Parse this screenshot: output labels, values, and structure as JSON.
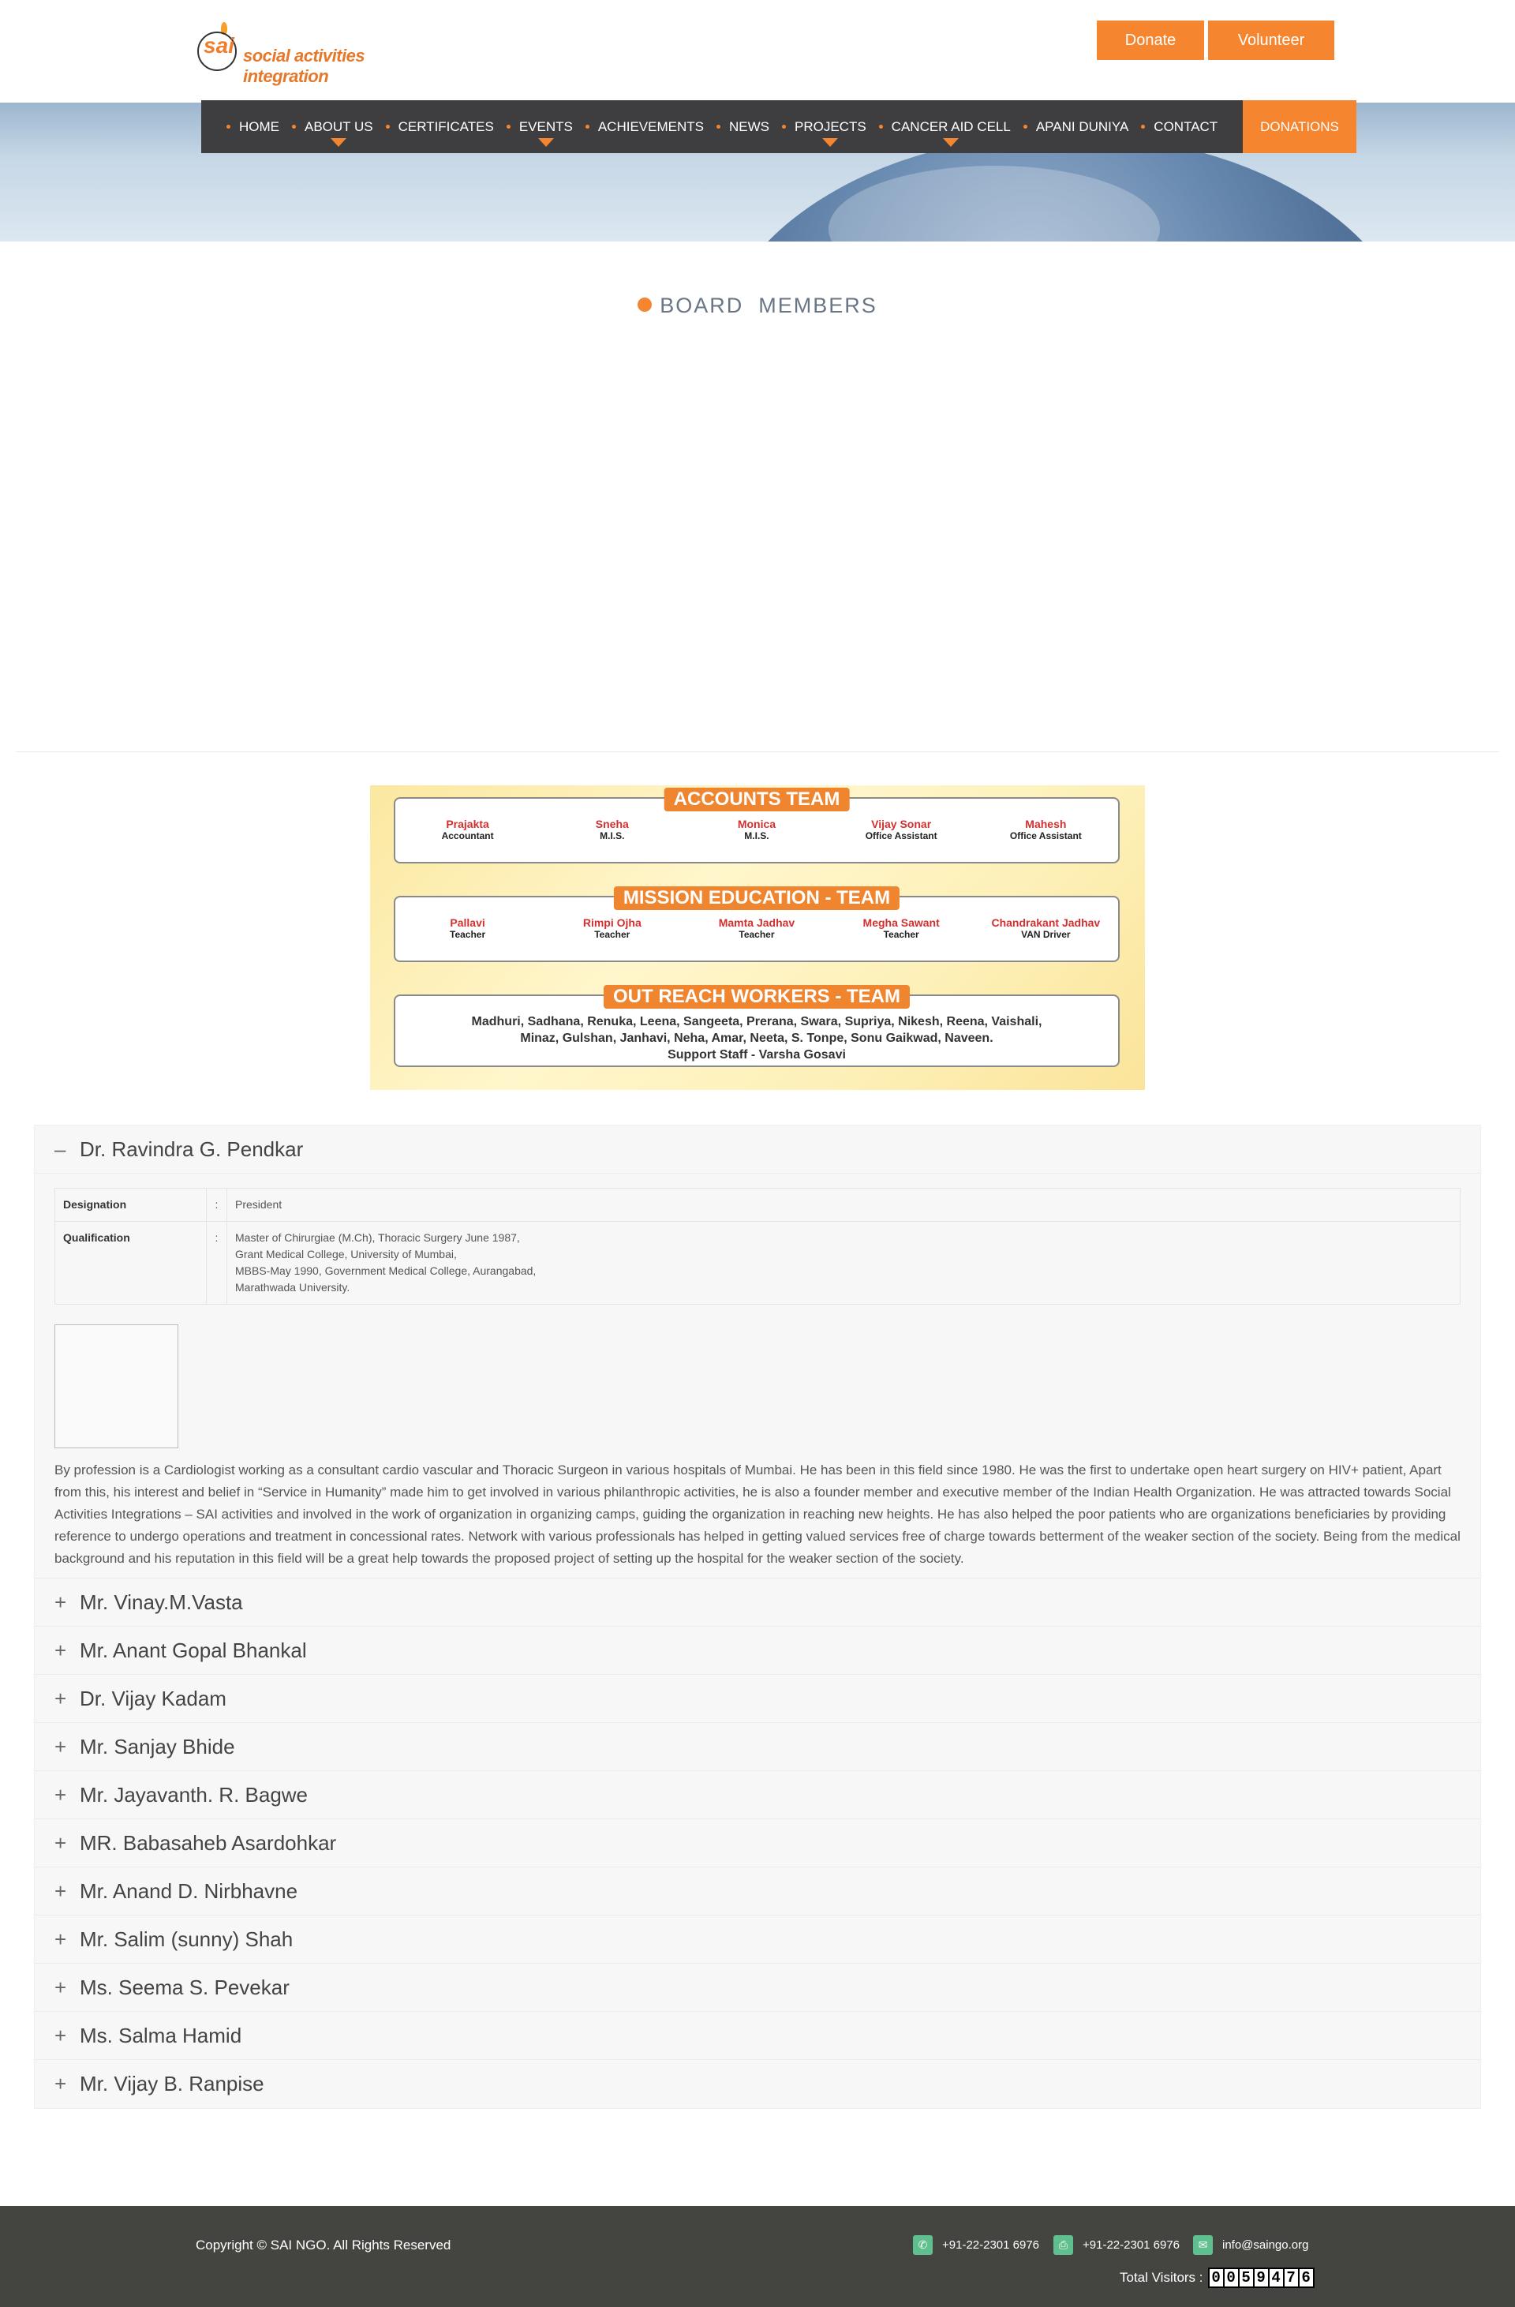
{
  "header": {
    "logo_mark": "sai",
    "logo_text": "social activities integration",
    "donate_label": "Donate",
    "volunteer_label": "Volunteer"
  },
  "nav": {
    "items": [
      {
        "label": "HOME",
        "has_dropdown": false
      },
      {
        "label": "ABOUT US",
        "has_dropdown": true
      },
      {
        "label": "CERTIFICATES",
        "has_dropdown": false
      },
      {
        "label": "EVENTS",
        "has_dropdown": true
      },
      {
        "label": "ACHIEVEMENTS",
        "has_dropdown": false
      },
      {
        "label": "NEWS",
        "has_dropdown": false
      },
      {
        "label": "PROJECTS",
        "has_dropdown": true
      },
      {
        "label": "CANCER AID CELL",
        "has_dropdown": true
      },
      {
        "label": "APANI DUNIYA",
        "has_dropdown": false
      },
      {
        "label": "CONTACT",
        "has_dropdown": false
      }
    ],
    "donations_label": "DONATIONS"
  },
  "page_title": "BOARD  MEMBERS",
  "teams": {
    "accounts": {
      "title": "ACCOUNTS TEAM",
      "members": [
        {
          "name": "Prajakta",
          "role": "Accountant"
        },
        {
          "name": "Sneha",
          "role": "M.I.S."
        },
        {
          "name": "Monica",
          "role": "M.I.S."
        },
        {
          "name": "Vijay Sonar",
          "role": "Office Assistant"
        },
        {
          "name": "Mahesh",
          "role": "Office Assistant"
        }
      ]
    },
    "mission": {
      "title": "MISSION EDUCATION - TEAM",
      "members": [
        {
          "name": "Pallavi",
          "role": "Teacher"
        },
        {
          "name": "Rimpi Ojha",
          "role": "Teacher"
        },
        {
          "name": "Mamta Jadhav",
          "role": "Teacher"
        },
        {
          "name": "Megha Sawant",
          "role": "Teacher"
        },
        {
          "name": "Chandrakant Jadhav",
          "role": "VAN Driver"
        }
      ]
    },
    "outreach": {
      "title": "OUT REACH WORKERS - TEAM",
      "line1": "Madhuri, Sadhana, Renuka, Leena, Sangeeta, Prerana, Swara, Supriya, Nikesh, Reena, Vaishali,",
      "line2": "Minaz, Gulshan, Janhavi, Neha, Amar, Neeta, S. Tonpe, Sonu Gaikwad, Naveen.",
      "line3": "Support Staff - Varsha Gosavi"
    }
  },
  "accordion": {
    "open": {
      "sign": "–",
      "name": "Dr. Ravindra G. Pendkar",
      "designation_label": "Designation",
      "designation_value": "President",
      "qualification_label": "Qualification",
      "colon": ":",
      "qualification_lines": [
        "Master of Chirurgiae (M.Ch), Thoracic Surgery June 1987,",
        "Grant Medical College, University of Mumbai,",
        "MBBS-May 1990, Government Medical College, Aurangabad,",
        "Marathwada University."
      ],
      "bio": "By profession is a Cardiologist working as a consultant cardio vascular and Thoracic Surgeon in various hospitals of Mumbai. He has been in this field since 1980. He was the first to undertake open heart surgery on HIV+ patient, Apart from this, his interest and belief in “Service in Humanity” made him to get involved in various philanthropic activities, he is also a founder member and executive member of the Indian Health Organization. He was attracted towards Social Activities Integrations – SAI activities and involved in the work of organization in organizing camps, guiding the organization in reaching new heights. He has also helped the poor patients who are organizations beneficiaries by providing reference to undergo operations and treatment in concessional rates. Network with various professionals has helped in getting valued services free of charge towards betterment of the weaker section of the society. Being from the medical background and his reputation in this field will be a great help towards the proposed project of setting up the hospital for the weaker section of the society."
    },
    "collapsed_sign": "+",
    "collapsed": [
      "Mr. Vinay.M.Vasta",
      "Mr. Anant Gopal Bhankal",
      "Dr. Vijay Kadam",
      "Mr. Sanjay Bhide",
      "Mr. Jayavanth. R. Bagwe",
      "MR. Babasaheb Asardohkar",
      "Mr. Anand D. Nirbhavne",
      "Mr. Salim (sunny) Shah",
      "Ms. Seema S. Pevekar",
      "Ms. Salma Hamid",
      "Mr. Vijay B. Ranpise"
    ]
  },
  "footer": {
    "copyright": "Copyright © SAI NGO. All Rights Reserved",
    "phone": "+91-22-2301 6976",
    "fax": "+91-22-2301 6976",
    "email": "info@saingo.org",
    "visitors_label": "Total Visitors :",
    "visitor_digits": [
      "0",
      "0",
      "5",
      "9",
      "4",
      "7",
      "6"
    ],
    "icon_color": "#5fbf8e"
  },
  "colors": {
    "accent": "#f5852f",
    "nav_bg": "#3e3e40",
    "footer_bg": "#444441"
  }
}
